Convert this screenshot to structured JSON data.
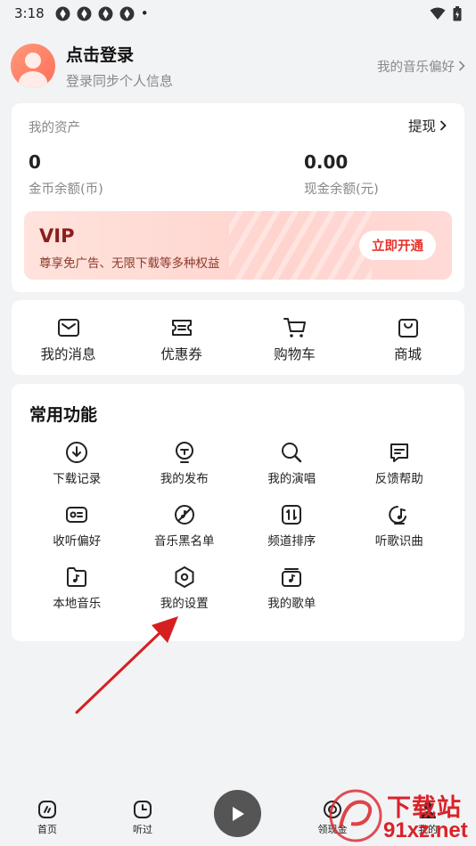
{
  "status_bar": {
    "time": "3:18",
    "notification_icons": [
      "app-icon",
      "app-icon",
      "app-icon",
      "app-icon"
    ],
    "dot": "•"
  },
  "profile": {
    "login_title": "点击登录",
    "login_subtitle": "登录同步个人信息",
    "preference_link": "我的音乐偏好"
  },
  "assets": {
    "header": "我的资产",
    "withdraw_label": "提现",
    "coin_value": "0",
    "coin_label": "金币余额(币)",
    "cash_value": "0.00",
    "cash_label": "现金余额(元)"
  },
  "vip": {
    "title": "VIP",
    "subtitle": "尊享免广告、无限下载等多种权益",
    "button_label": "立即开通"
  },
  "quick_actions": [
    {
      "label": "我的消息",
      "icon": "mail-icon"
    },
    {
      "label": "优惠券",
      "icon": "coupon-icon"
    },
    {
      "label": "购物车",
      "icon": "cart-icon"
    },
    {
      "label": "商城",
      "icon": "shopping-bag-icon"
    }
  ],
  "functions": {
    "title": "常用功能",
    "items": [
      {
        "label": "下载记录",
        "icon": "download-icon"
      },
      {
        "label": "我的发布",
        "icon": "publish-icon"
      },
      {
        "label": "我的演唱",
        "icon": "microphone-search-icon"
      },
      {
        "label": "反馈帮助",
        "icon": "feedback-icon"
      },
      {
        "label": "收听偏好",
        "icon": "preference-card-icon"
      },
      {
        "label": "音乐黑名单",
        "icon": "block-icon"
      },
      {
        "label": "频道排序",
        "icon": "sort-icon"
      },
      {
        "label": "听歌识曲",
        "icon": "music-recognition-icon"
      },
      {
        "label": "本地音乐",
        "icon": "local-music-icon"
      },
      {
        "label": "我的设置",
        "icon": "settings-hexagon-icon"
      },
      {
        "label": "我的歌单",
        "icon": "playlist-icon"
      }
    ]
  },
  "tabbar": {
    "items": [
      {
        "label": "首页",
        "icon": "home-icon"
      },
      {
        "label": "听过",
        "icon": "clock-icon"
      },
      {
        "label": "领现金",
        "icon": "cash-coin-icon"
      },
      {
        "label": "我的",
        "icon": "user-icon"
      }
    ],
    "play_icon": "play-icon"
  },
  "watermark": {
    "title": "下载站",
    "url": "91xz.net"
  },
  "colors": {
    "accent_red": "#e8332d",
    "vip_title": "#8c1d1d",
    "background": "#f2f3f5",
    "watermark_red": "#d9232a",
    "annotation_arrow": "#d62020"
  }
}
